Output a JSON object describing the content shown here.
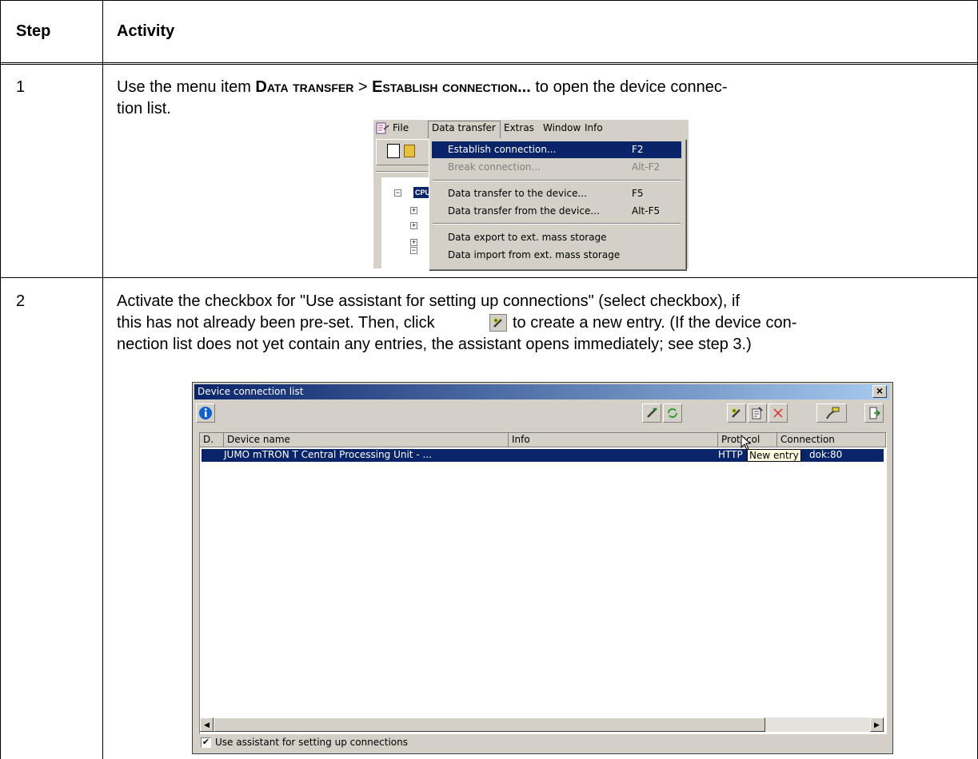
{
  "table": {
    "headers": [
      "Step",
      "Activity"
    ],
    "rows": [
      {
        "step": "1",
        "text_parts": [
          "Use the menu item ",
          "Data transfer",
          " > ",
          "Establish connection...",
          " to open the device connec-"
        ],
        "text_line2": "tion list."
      },
      {
        "step": "2",
        "lines": [
          "Activate the checkbox for \"Use assistant for setting up connections\" (select checkbox), if",
          "this has not already been pre-set. Then, click",
          "to create a new entry. (If the device con-",
          "nection list does not yet contain any entries, the assistant opens immediately; see step 3.)"
        ]
      }
    ]
  },
  "menu_screenshot": {
    "menubar": [
      "File",
      "Data transfer",
      "Extras",
      "Window",
      "Info"
    ],
    "tree_label": "CPU",
    "items": [
      {
        "label": "Establish connection...",
        "shortcut": "F2",
        "state": "highlighted"
      },
      {
        "label": "Break connection...",
        "shortcut": "Alt-F2",
        "state": "disabled"
      },
      {
        "label": "Data transfer to the device...",
        "shortcut": "F5",
        "state": "normal"
      },
      {
        "label": "Data transfer from the device...",
        "shortcut": "Alt-F5",
        "state": "normal"
      },
      {
        "label": "Data export to ext. mass storage",
        "shortcut": "",
        "state": "normal"
      },
      {
        "label": "Data import from ext. mass storage",
        "shortcut": "",
        "state": "normal"
      }
    ],
    "highlight_color": "#0a246a"
  },
  "dialog": {
    "title": "Device connection list",
    "close_glyph": "×",
    "columns": [
      "D.",
      "Device name",
      "Info",
      "Protocol",
      "Connection"
    ],
    "row": {
      "device_name": "JUMO mTRON T Central Processing Unit - ...",
      "protocol": "HTTP",
      "connection": "dok:80"
    },
    "tooltip": "New entry",
    "checkbox_label": "Use assistant for setting up connections",
    "checkbox_checked": true,
    "selection_color": "#0a246a"
  }
}
